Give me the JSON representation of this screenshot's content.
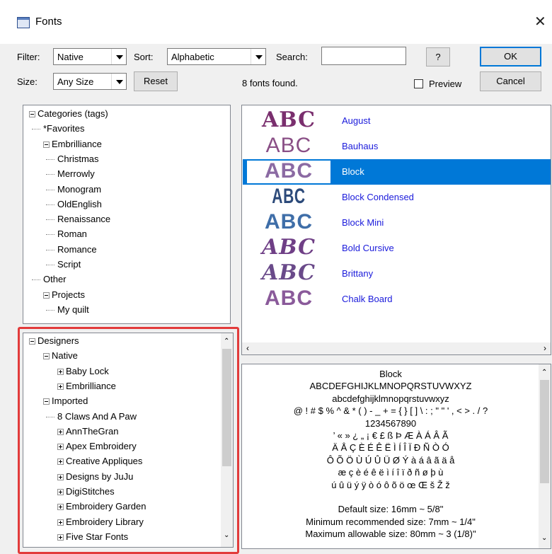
{
  "window": {
    "title": "Fonts",
    "close_glyph": "✕"
  },
  "toolbar": {
    "filter_label": "Filter:",
    "filter_value": "Native",
    "sort_label": "Sort:",
    "sort_value": "Alphabetic",
    "search_label": "Search:",
    "search_value": "",
    "help_label": "?",
    "ok_label": "OK",
    "size_label": "Size:",
    "size_value": "Any Size",
    "reset_label": "Reset",
    "found_text": "8 fonts found.",
    "preview_label": "Preview",
    "preview_checked": false,
    "cancel_label": "Cancel"
  },
  "categories": [
    {
      "label": "Categories (tags)",
      "level": 0,
      "expander": "minus"
    },
    {
      "label": "*Favorites",
      "level": 1
    },
    {
      "label": "Embrilliance",
      "level": 1,
      "expander": "minus"
    },
    {
      "label": "Christmas",
      "level": 2
    },
    {
      "label": "Merrowly",
      "level": 2
    },
    {
      "label": "Monogram",
      "level": 2
    },
    {
      "label": "OldEnglish",
      "level": 2
    },
    {
      "label": "Renaissance",
      "level": 2
    },
    {
      "label": "Roman",
      "level": 2
    },
    {
      "label": "Romance",
      "level": 2
    },
    {
      "label": "Script",
      "level": 2
    },
    {
      "label": "Other",
      "level": 1
    },
    {
      "label": "Projects",
      "level": 1,
      "expander": "minus"
    },
    {
      "label": "My quilt",
      "level": 2
    }
  ],
  "designers": [
    {
      "label": "Designers",
      "level": 0,
      "expander": "minus"
    },
    {
      "label": "Native",
      "level": 1,
      "expander": "minus"
    },
    {
      "label": "Baby Lock",
      "level": 2,
      "expander": "plus"
    },
    {
      "label": "Embrilliance",
      "level": 2,
      "expander": "plus"
    },
    {
      "label": "Imported",
      "level": 1,
      "expander": "minus"
    },
    {
      "label": "8 Claws And A Paw",
      "level": 2
    },
    {
      "label": "AnnTheGran",
      "level": 2,
      "expander": "plus"
    },
    {
      "label": "Apex Embroidery",
      "level": 2,
      "expander": "plus"
    },
    {
      "label": "Creative Appliques",
      "level": 2,
      "expander": "plus"
    },
    {
      "label": "Designs by JuJu",
      "level": 2,
      "expander": "plus"
    },
    {
      "label": "DigiStitches",
      "level": 2,
      "expander": "plus"
    },
    {
      "label": "Embroidery Garden",
      "level": 2,
      "expander": "plus"
    },
    {
      "label": "Embroidery Library",
      "level": 2,
      "expander": "plus"
    },
    {
      "label": "Five Star Fonts",
      "level": 2,
      "expander": "plus"
    }
  ],
  "fonts": [
    {
      "name": "August",
      "sample": "ABC",
      "color": "#7a2f6e",
      "style": "serif",
      "selected": false
    },
    {
      "name": "Bauhaus",
      "sample": "ABC",
      "color": "#8a4f86",
      "style": "thin",
      "selected": false
    },
    {
      "name": "Block",
      "sample": "ABC",
      "color": "#8b6aa3",
      "style": "block",
      "selected": true
    },
    {
      "name": "Block Condensed",
      "sample": "ABC",
      "color": "#2c4a7a",
      "style": "condensed",
      "selected": false
    },
    {
      "name": "Block Mini",
      "sample": "ABC",
      "color": "#3f6ea8",
      "style": "block",
      "selected": false
    },
    {
      "name": "Bold Cursive",
      "sample": "ABC",
      "color": "#6f3f86",
      "style": "cursive",
      "selected": false
    },
    {
      "name": "Brittany",
      "sample": "ABC",
      "color": "#6a4a8a",
      "style": "cursive",
      "selected": false
    },
    {
      "name": "Chalk Board",
      "sample": "ABC",
      "color": "#8a5a9a",
      "style": "block",
      "selected": false
    }
  ],
  "preview": {
    "lines": [
      "Block",
      "ABCDEFGHIJKLMNOPQRSTUVWXYZ",
      "abcdefghijklmnopqrstuvwxyz",
      "@ ! # $ % ^ & * ( ) - _ + = { } [ ] \\ : ; \" \" ' , < > . / ?",
      "1234567890",
      "’ « » ¿ „ ¡ € £ ß Þ Æ À Á Â Ã",
      "Ä Å Ç È É Ê Ë Ì Í Î Ï Ð Ñ Ò Ó",
      "Ô Õ Ö Ù Ú Û Ü Ø Ý à á â ã ä å",
      "æ ç è é ê ë ì í î ï ð ñ ø þ ù",
      "ú û ü ý ÿ ò ó ô õ ö œ Œ š Ž ž",
      "",
      "Default size:  16mm ~ 5/8\"",
      "Minimum recommended size:   7mm ~ 1/4\"",
      "Maximum allowable size:  80mm ~ 3 (1/8)\""
    ]
  },
  "colors": {
    "selection": "#0078d7",
    "link": "#1a1adb",
    "highlight_border": "#e23b3b"
  }
}
